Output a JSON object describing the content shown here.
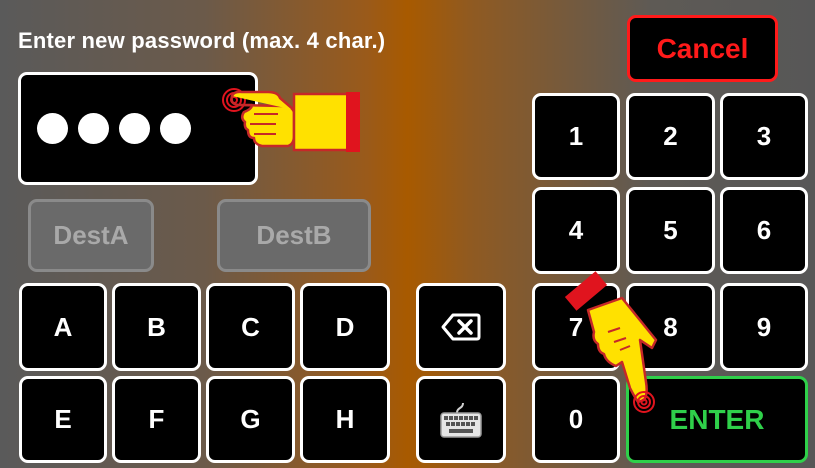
{
  "prompt": "Enter new password (max. 4 char.)",
  "password": {
    "mask": "●●●●",
    "length": 4
  },
  "cancel_label": "Cancel",
  "enter_label": "ENTER",
  "destinations": [
    "DestA",
    "DestB"
  ],
  "letters": [
    "A",
    "B",
    "C",
    "D",
    "E",
    "F",
    "G",
    "H"
  ],
  "numpad": [
    "1",
    "2",
    "3",
    "4",
    "5",
    "6",
    "7",
    "8",
    "9",
    "0"
  ],
  "icons": {
    "backspace": "backspace-icon",
    "keyboard": "keyboard-icon",
    "hand": "pointing-hand-icon"
  },
  "colors": {
    "cancel": "#ff1a1a",
    "enter": "#2fd04a",
    "key_bg": "#000000",
    "key_border": "#ffffff",
    "disabled_bg": "#6a6a6a"
  }
}
